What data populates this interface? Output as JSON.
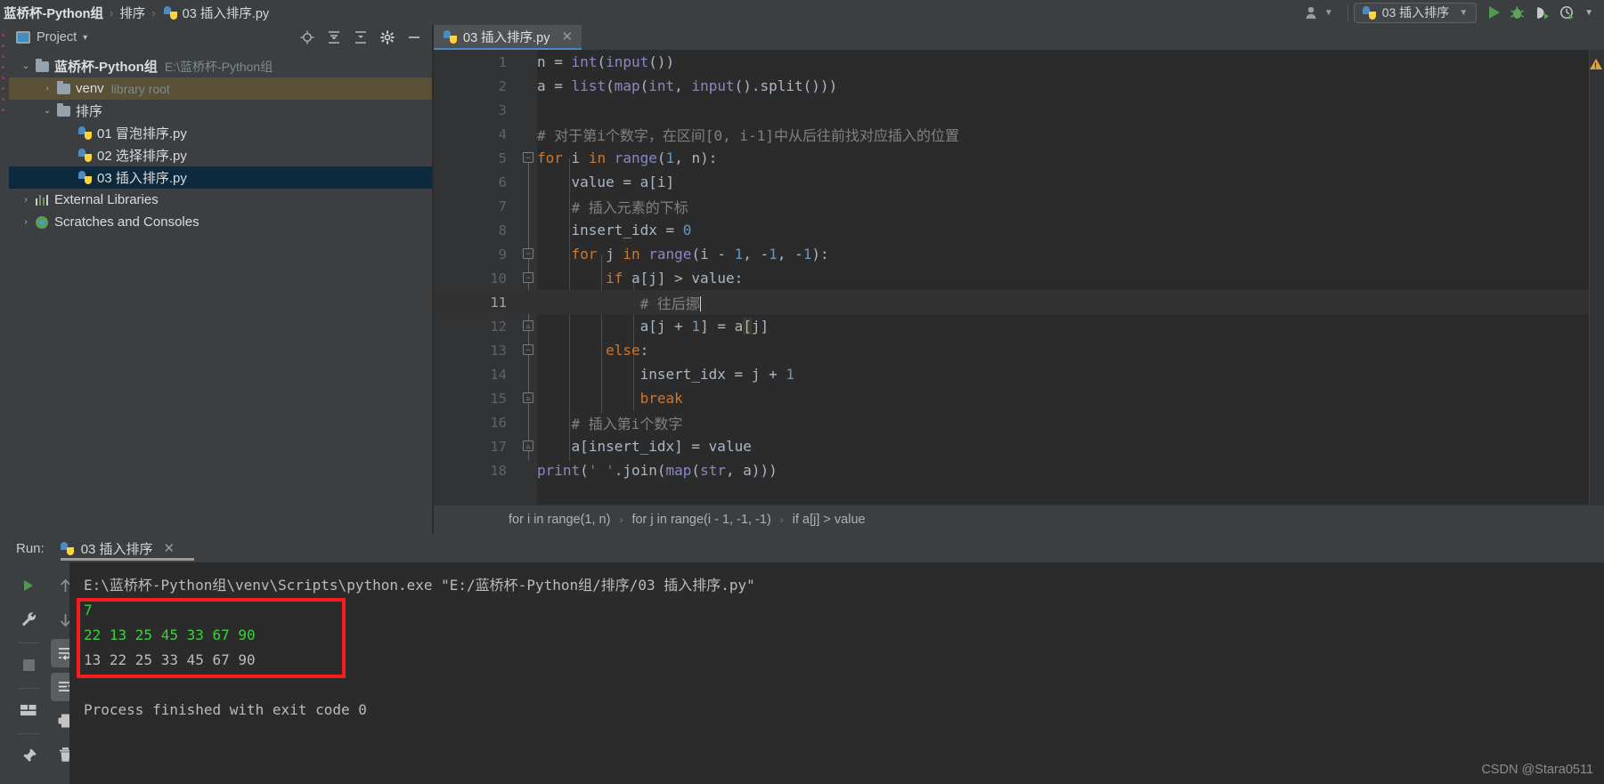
{
  "titlebar": {
    "crumbs": [
      "蓝桥杯-Python组",
      "排序",
      "03 插入排序.py"
    ],
    "separator": "›",
    "user_icon": "user-icon",
    "run_config": "03 插入排序",
    "actions": [
      "run-icon",
      "debug-icon",
      "coverage-icon",
      "profile-icon",
      "chevron-down-icon"
    ]
  },
  "project_tool": {
    "title": "Project",
    "dropdown_caret": "▾",
    "icons": [
      "locate-icon",
      "expand-all-icon",
      "collapse-all-icon",
      "gear-icon",
      "hide-icon"
    ],
    "tree": [
      {
        "label": "蓝桥杯-Python组",
        "sub": "E:\\蓝桥杯-Python组",
        "icon": "folder-icon",
        "arrow": "⌄",
        "depth": 0,
        "bold": true,
        "state": "none"
      },
      {
        "label": "venv",
        "sub": "library root",
        "icon": "folder-icon",
        "arrow": "›",
        "depth": 1,
        "bold": false,
        "state": "venv"
      },
      {
        "label": "排序",
        "sub": "",
        "icon": "folder-icon",
        "arrow": "⌄",
        "depth": 1,
        "bold": false,
        "state": "none"
      },
      {
        "label": "01 冒泡排序.py",
        "sub": "",
        "icon": "python-file-icon",
        "arrow": "",
        "depth": 2,
        "bold": false,
        "state": "none"
      },
      {
        "label": "02 选择排序.py",
        "sub": "",
        "icon": "python-file-icon",
        "arrow": "",
        "depth": 2,
        "bold": false,
        "state": "none"
      },
      {
        "label": "03 插入排序.py",
        "sub": "",
        "icon": "python-file-icon",
        "arrow": "",
        "depth": 2,
        "bold": false,
        "state": "file"
      },
      {
        "label": "External Libraries",
        "sub": "",
        "icon": "libraries-icon",
        "arrow": "›",
        "depth": 0,
        "bold": false,
        "state": "none"
      },
      {
        "label": "Scratches and Consoles",
        "sub": "",
        "icon": "scratches-icon",
        "arrow": "›",
        "depth": 0,
        "bold": false,
        "state": "none"
      }
    ]
  },
  "editor": {
    "tab": {
      "label": "03 插入排序.py",
      "icon": "python-file-icon",
      "close": "✕"
    },
    "warning_icon": "warning-triangle-icon",
    "current_line": 11,
    "lines": [
      {
        "n": 1,
        "text": "n = int(input())"
      },
      {
        "n": 2,
        "text": "a = list(map(int, input().split()))"
      },
      {
        "n": 3,
        "text": ""
      },
      {
        "n": 4,
        "text": "# 对于第i个数字，在区间[0, i-1]中从后往前找对应插入的位置"
      },
      {
        "n": 5,
        "text": "for i in range(1, n):"
      },
      {
        "n": 6,
        "text": "    value = a[i]"
      },
      {
        "n": 7,
        "text": "    # 插入元素的下标"
      },
      {
        "n": 8,
        "text": "    insert_idx = 0"
      },
      {
        "n": 9,
        "text": "    for j in range(i - 1, -1, -1):"
      },
      {
        "n": 10,
        "text": "        if a[j] > value:"
      },
      {
        "n": 11,
        "text": "            # 往后挪"
      },
      {
        "n": 12,
        "text": "            a[j + 1] = a[j]"
      },
      {
        "n": 13,
        "text": "        else:"
      },
      {
        "n": 14,
        "text": "            insert_idx = j + 1"
      },
      {
        "n": 15,
        "text": "            break"
      },
      {
        "n": 16,
        "text": "    # 插入第i个数字"
      },
      {
        "n": 17,
        "text": "    a[insert_idx] = value"
      },
      {
        "n": 18,
        "text": "print(' '.join(map(str, a)))"
      }
    ]
  },
  "breadcrumb_bar": {
    "items": [
      "for i in range(1, n)",
      "for j in range(i - 1, -1, -1)",
      "if a[j] > value"
    ],
    "separator": "›"
  },
  "run_panel": {
    "label": "Run:",
    "tab_title": "03 插入排序",
    "tab_icon": "python-file-icon",
    "close": "✕",
    "sidebar_left": [
      "run-icon",
      "settings-wrench-icon",
      "stop-icon",
      "layout-icon",
      "pin-icon"
    ],
    "sidebar_right": [
      "up-arrow-icon",
      "down-arrow-icon",
      "soft-wrap-icon",
      "scroll-to-end-icon",
      "print-icon",
      "trash-icon"
    ],
    "console": [
      {
        "text": "E:\\蓝桥杯-Python组\\venv\\Scripts\\python.exe \"E:/蓝桥杯-Python组/排序/03 插入排序.py\"",
        "color": "default"
      },
      {
        "text": "7",
        "color": "green"
      },
      {
        "text": "22 13 25 45 33 67 90",
        "color": "green"
      },
      {
        "text": "13 22 25 33 45 67 90",
        "color": "default"
      },
      {
        "text": "",
        "color": "default"
      },
      {
        "text": "Process finished with exit code 0",
        "color": "default"
      }
    ],
    "highlight_box_color": "#ff1a1a"
  },
  "watermark": "CSDN @Stara0511",
  "colors": {
    "background": "#3c3f41",
    "editor_bg": "#2b2b2b",
    "gutter_bg": "#313335",
    "selection_blue": "#0d293e",
    "venv_highlight": "#5a5036",
    "keyword": "#cc7832",
    "number": "#6897bb",
    "comment": "#808080",
    "string": "#6a8759",
    "builtin": "#8888c6",
    "text": "#a9b7c6",
    "tab_underline": "#4a88c7",
    "console_green": "#3ad23a"
  }
}
